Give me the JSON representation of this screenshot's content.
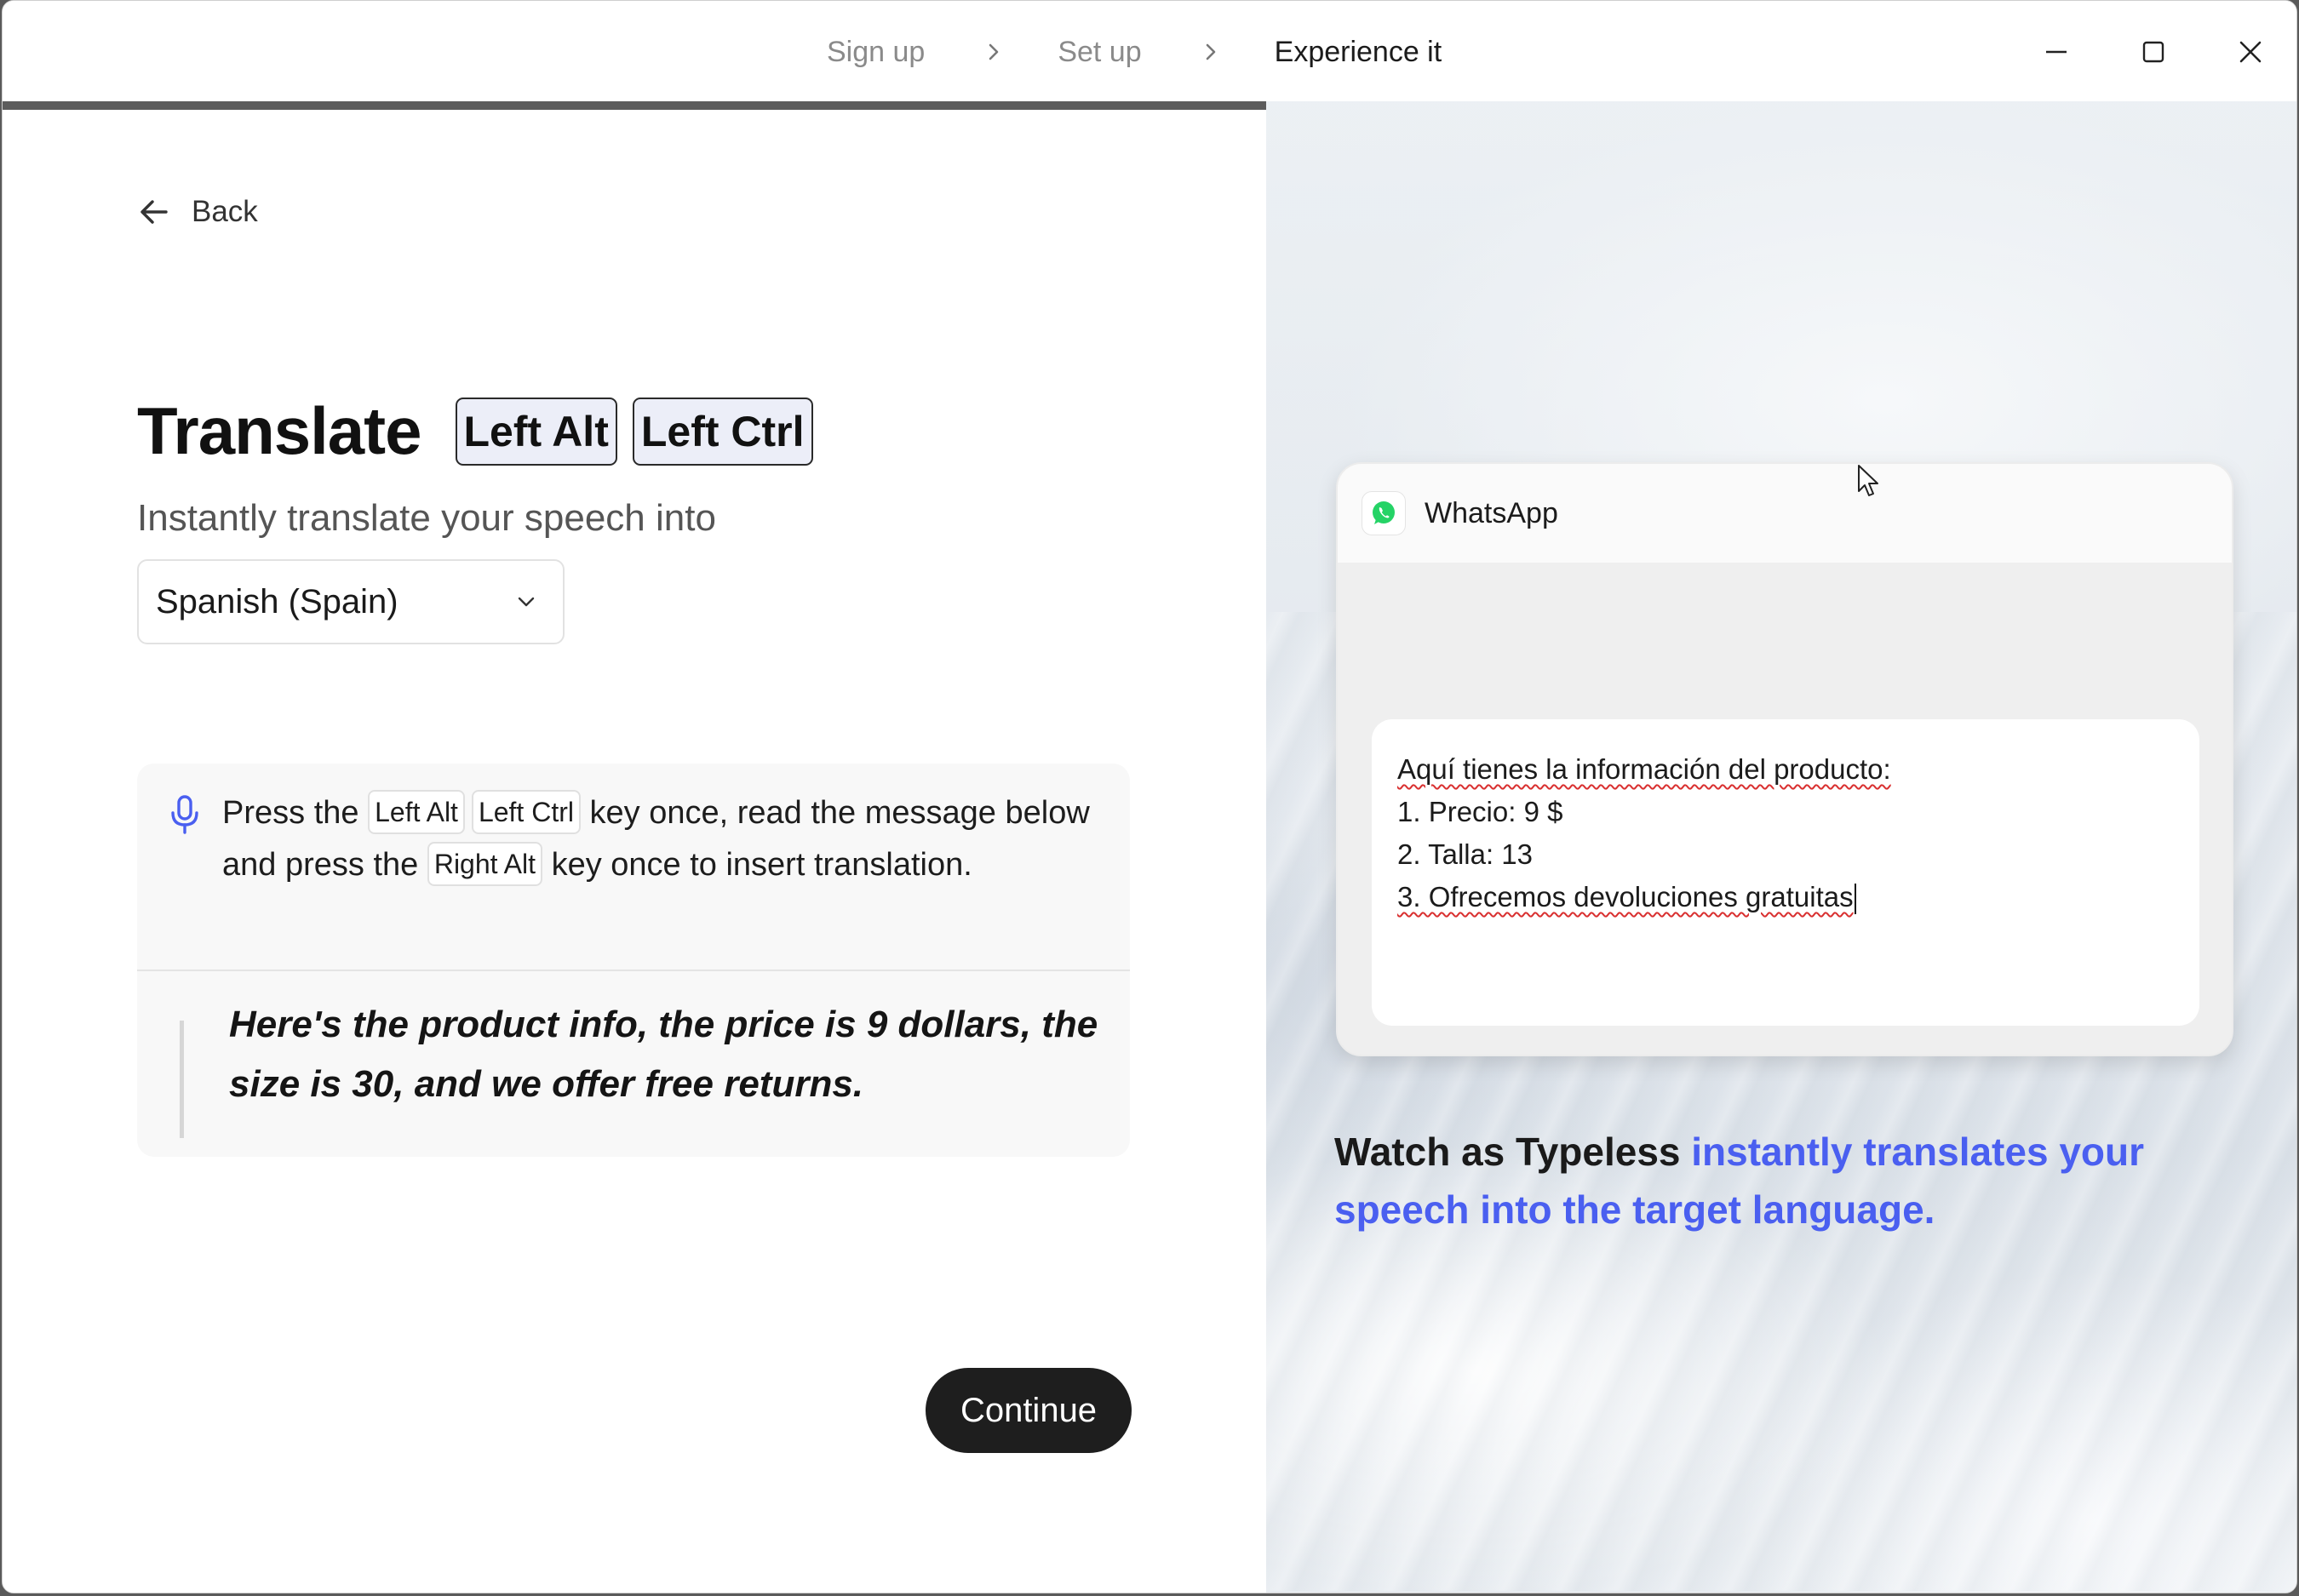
{
  "steps": [
    "Sign up",
    "Set up",
    "Experience it"
  ],
  "active_step": 2,
  "progress_fraction": 0.8,
  "window_controls": {
    "minimize": "minimize-icon",
    "maximize": "maximize-icon",
    "close": "close-icon"
  },
  "back_label": "Back",
  "heading": {
    "title": "Translate",
    "hotkeys": [
      "Left Alt",
      "Left Ctrl"
    ]
  },
  "subtitle": "Instantly translate your speech into",
  "language_select": {
    "value": "Spanish (Spain)"
  },
  "instructions": {
    "part1": "Press the",
    "key1": "Left Alt",
    "key2": "Left Ctrl",
    "part2": "key once, read the message below and press the",
    "key3": "Right Alt",
    "part3": "key once to insert translation."
  },
  "quote": "Here's the product info, the price is 9 dollars, the size is 30, and we offer free returns.",
  "continue_label": "Continue",
  "whatsapp": {
    "app_name": "WhatsApp",
    "message_lines": [
      "Aquí tienes la información del producto:",
      "1. Precio: 9 $",
      "2. Talla: 13",
      "3. Ofrecemos devoluciones gratuitas"
    ]
  },
  "tagline": {
    "lead": "Watch as Typeless ",
    "accent": "instantly translates your speech into the target language."
  },
  "colors": {
    "accent": "#4a5ff0",
    "button": "#1e1e1e",
    "progress": "#5c5c5c",
    "whatsapp_green": "#25d366"
  }
}
